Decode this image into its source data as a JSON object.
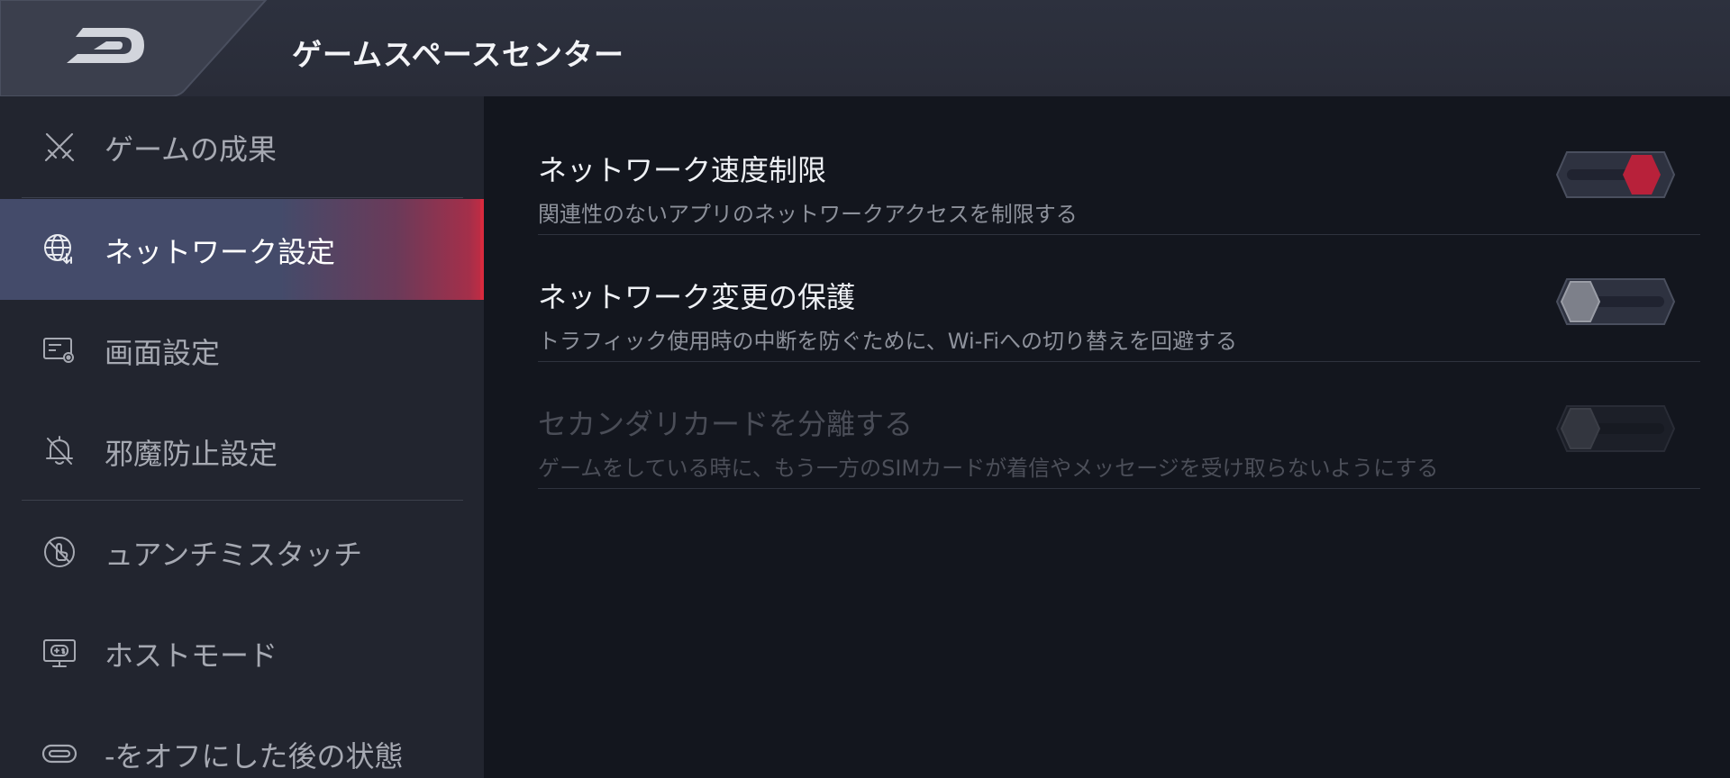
{
  "header": {
    "app_title": "ゲームスペースセンター",
    "logo_icon": "rog-logo-icon"
  },
  "sidebar": {
    "items": [
      {
        "label": "ゲームの成果",
        "icon": "crossed-swords-icon",
        "active": false
      },
      {
        "label": "ネットワーク設定",
        "icon": "globe-network-icon",
        "active": true
      },
      {
        "label": "画面設定",
        "icon": "display-settings-icon",
        "active": false
      },
      {
        "label": "邪魔防止設定",
        "icon": "bell-off-icon",
        "active": false
      },
      {
        "label": "ュアンチミスタッチ",
        "icon": "touch-block-icon",
        "active": false
      },
      {
        "label": "ホストモード",
        "icon": "monitor-gamepad-icon",
        "active": false
      },
      {
        "label": "-をオフにした後の状態",
        "icon": "toggle-pill-icon",
        "active": false
      }
    ]
  },
  "settings": [
    {
      "title": "ネットワーク速度制限",
      "description": "関連性のないアプリのネットワークアクセスを制限する",
      "enabled": true,
      "disabled": false
    },
    {
      "title": "ネットワーク変更の保護",
      "description": "トラフィック使用時の中断を防ぐために、Wi-Fiへの切り替えを回避する",
      "enabled": false,
      "disabled": false
    },
    {
      "title": "セカンダリカードを分離する",
      "description": "ゲームをしている時に、もう一方のSIMカードが着信やメッセージを受け取らないようにする",
      "enabled": false,
      "disabled": true
    }
  ],
  "colors": {
    "accent": "#c62b42",
    "active_nav": "#444b6a",
    "sidebar_bg": "#22252f",
    "main_bg": "#13161e",
    "header_bg": "#2d313e"
  }
}
